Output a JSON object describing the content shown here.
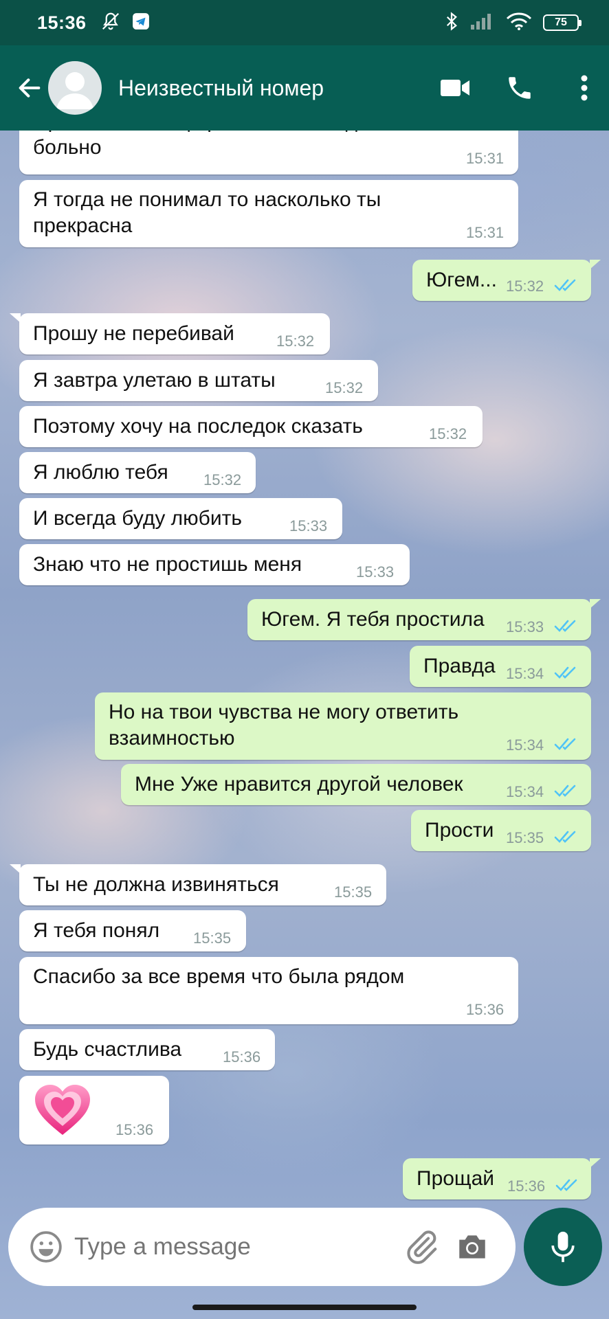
{
  "status_bar": {
    "time": "15:36",
    "battery": "75"
  },
  "header": {
    "contact_name": "Неизвестный номер"
  },
  "messages": [
    {
      "dir": "in",
      "text": "Прости меня еще раз за то что сделал тебе больно",
      "time": "15:31"
    },
    {
      "dir": "in",
      "text": "Я тогда не понимал то насколько ты прекрасна",
      "time": "15:31"
    },
    {
      "dir": "out",
      "text": "Югем...",
      "time": "15:32"
    },
    {
      "dir": "in",
      "text": "Прошу не перебивай",
      "time": "15:32"
    },
    {
      "dir": "in",
      "text": "Я завтра улетаю в штаты",
      "time": "15:32"
    },
    {
      "dir": "in",
      "text": "Поэтому хочу на последок сказать",
      "time": "15:32"
    },
    {
      "dir": "in",
      "text": "Я люблю тебя",
      "time": "15:32"
    },
    {
      "dir": "in",
      "text": "И всегда буду любить",
      "time": "15:33"
    },
    {
      "dir": "in",
      "text": "Знаю что не простишь меня",
      "time": "15:33"
    },
    {
      "dir": "out",
      "text": "Югем. Я тебя простила",
      "time": "15:33"
    },
    {
      "dir": "out",
      "text": "Правда",
      "time": "15:34"
    },
    {
      "dir": "out",
      "text": "Но на твои чувства не могу ответить взаимностью",
      "time": "15:34"
    },
    {
      "dir": "out",
      "text": "Мне Уже нравится другой человек",
      "time": "15:34"
    },
    {
      "dir": "out",
      "text": "Прости",
      "time": "15:35"
    },
    {
      "dir": "in",
      "text": "Ты не должна извиняться",
      "time": "15:35"
    },
    {
      "dir": "in",
      "text": "Я тебя понял",
      "time": "15:35"
    },
    {
      "dir": "in",
      "text": "Спасибо за все время что была рядом",
      "time": "15:36"
    },
    {
      "dir": "in",
      "text": "Будь счастлива",
      "time": "15:36"
    },
    {
      "dir": "in",
      "text": "💗",
      "emoji": "growing-heart",
      "time": "15:36"
    },
    {
      "dir": "out",
      "text": "Прощай",
      "time": "15:36"
    }
  ],
  "input": {
    "placeholder": "Type a message"
  },
  "colors": {
    "header": "#075e54",
    "status_bar": "#0b5147",
    "outgoing_bubble": "#dcf8c6",
    "incoming_bubble": "#ffffff",
    "read_checks": "#4fc3f7"
  }
}
